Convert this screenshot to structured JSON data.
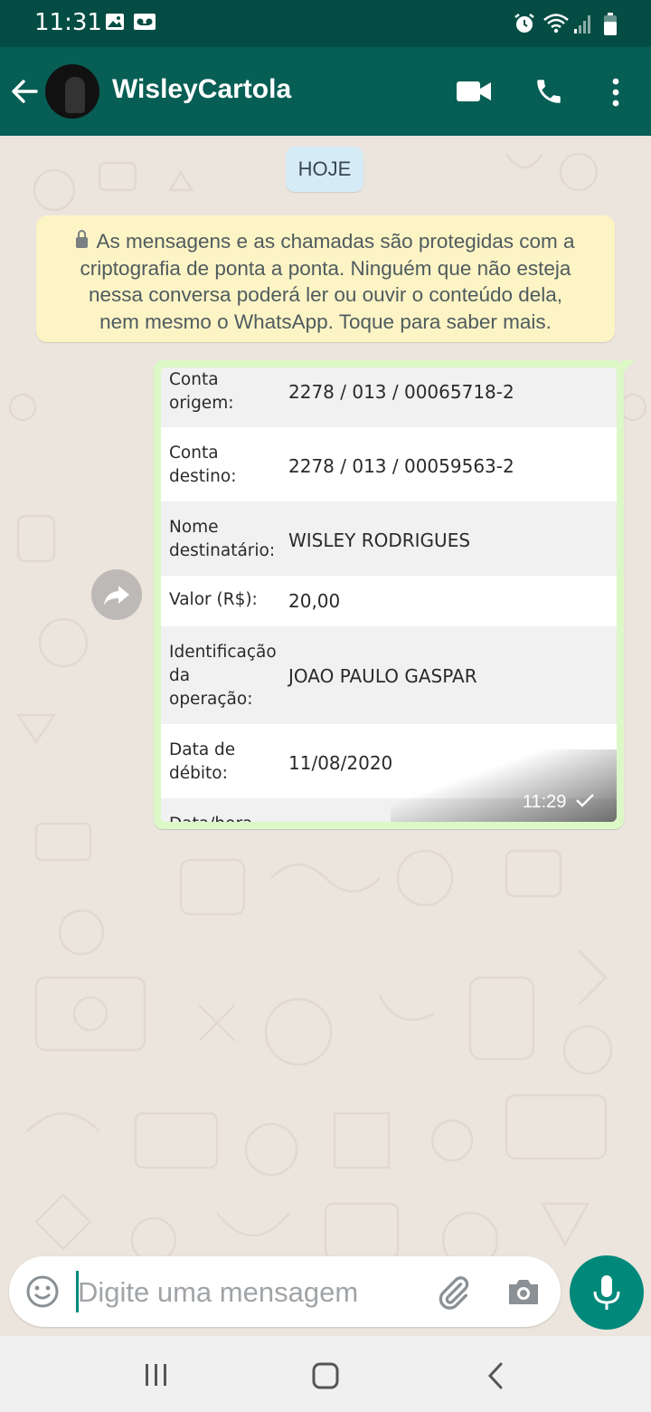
{
  "status_bar": {
    "time": "11:31"
  },
  "header": {
    "contact_name": "WisleyCartola"
  },
  "chat": {
    "date_chip": "HOJE",
    "encryption_notice": [
      "As mensagens e as chamadas são protegidas com a",
      "criptografia de ponta a ponta. Ninguém que não esteja",
      "nessa conversa poderá ler ou ouvir o conteúdo dela,",
      "nem mesmo o WhatsApp. Toque para saber mais."
    ],
    "message": {
      "time": "11:29",
      "rows": [
        {
          "label": [
            "Conta",
            "origem:"
          ],
          "value": "2278 / 013 / 00065718-2"
        },
        {
          "label": [
            "Conta",
            "destino:"
          ],
          "value": "2278 / 013 / 00059563-2"
        },
        {
          "label": [
            "Nome",
            "destinatário:"
          ],
          "value": "WISLEY RODRIGUES"
        },
        {
          "label": [
            "Valor (R$):"
          ],
          "value": "20,00"
        },
        {
          "label": [
            "Identificação",
            "da",
            "operação:"
          ],
          "value": "JOAO PAULO GASPAR"
        },
        {
          "label": [
            "Data de",
            "débito:"
          ],
          "value": "11/08/2020"
        },
        {
          "label": [
            "Data/hora"
          ],
          "value": ""
        }
      ]
    }
  },
  "composer": {
    "placeholder": "Digite uma mensagem"
  },
  "icons": [
    "back-arrow-icon",
    "video-call-icon",
    "phone-icon",
    "more-vert-icon",
    "emoji-icon",
    "attach-icon",
    "camera-icon",
    "mic-icon",
    "forward-icon",
    "lock-icon",
    "check-icon"
  ],
  "colors": {
    "header": "#075e54",
    "status_bar": "#054d44",
    "outgoing_bubble": "#dcf8c6",
    "notice": "#fdf4c5",
    "accent": "#00897b"
  }
}
